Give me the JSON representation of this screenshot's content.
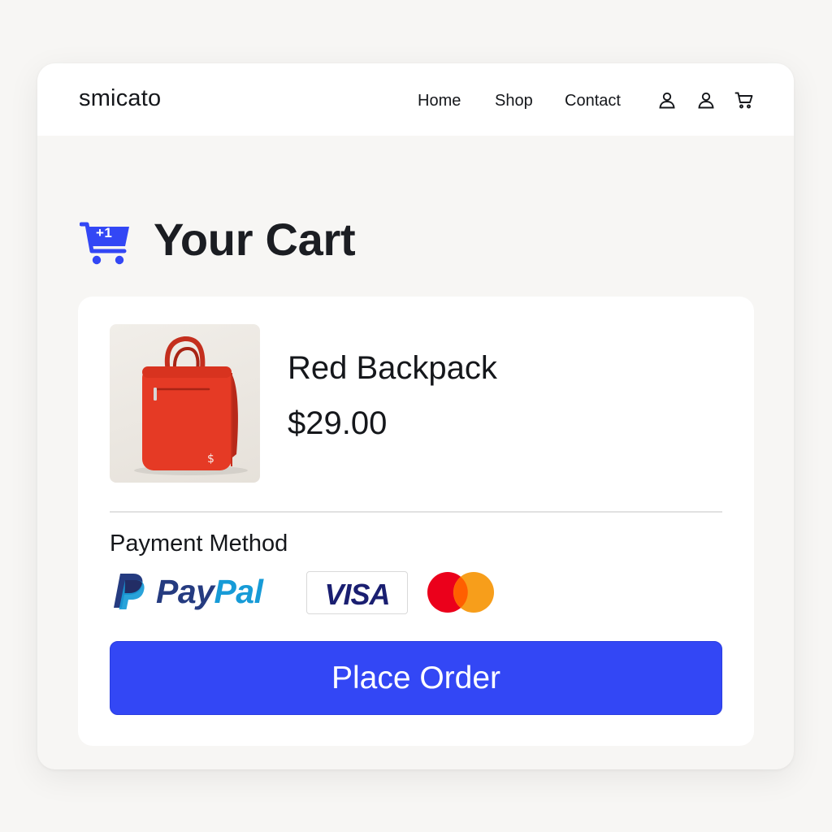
{
  "header": {
    "brand": "smicato",
    "nav": [
      {
        "label": "Home"
      },
      {
        "label": "Shop"
      },
      {
        "label": "Contact"
      }
    ],
    "icons": [
      "user-icon",
      "user-icon",
      "cart-icon"
    ]
  },
  "cart": {
    "badge": "+1",
    "title": "Your Cart",
    "accent_color": "#3347f5"
  },
  "item": {
    "name": "Red Backpack",
    "price": "$29.00",
    "image": "red-backpack",
    "image_color": "#e53a25"
  },
  "payment": {
    "label": "Payment Method",
    "paypal": {
      "part1": "Pay",
      "part2": "Pal"
    },
    "visa": "VISA",
    "mastercard": {
      "left_color": "#eb001b",
      "right_color": "#f79e1b"
    }
  },
  "actions": {
    "place_order": "Place Order"
  }
}
